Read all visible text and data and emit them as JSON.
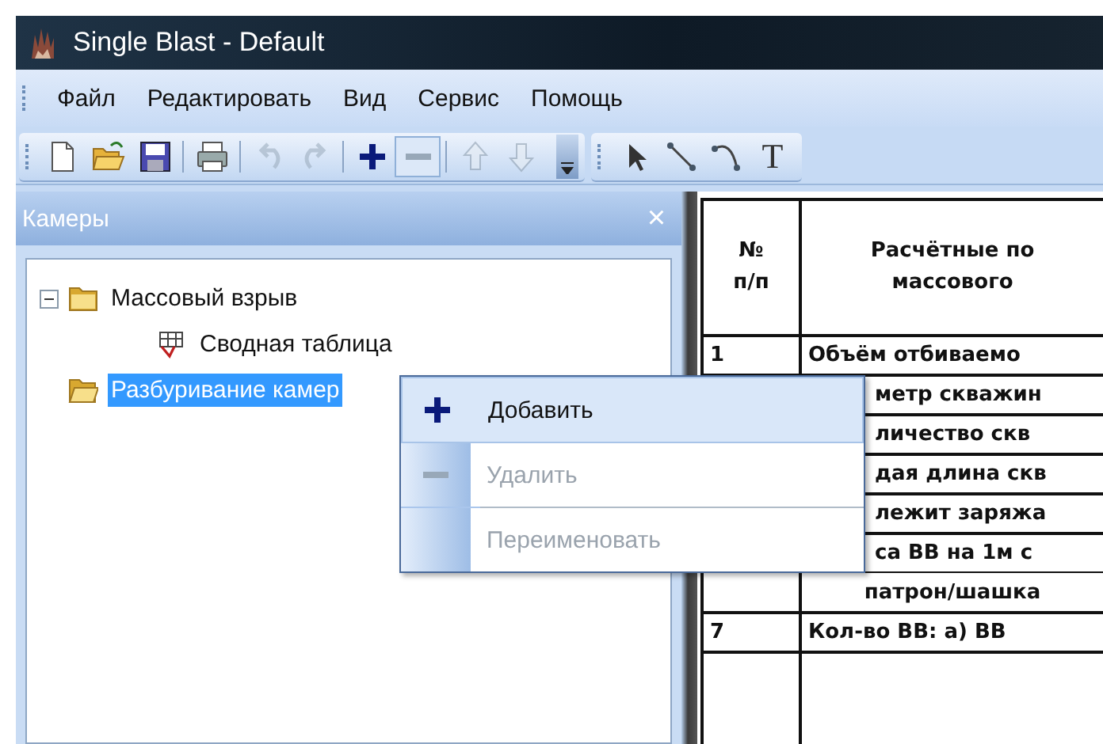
{
  "window": {
    "title": "Single Blast - Default"
  },
  "menu_bar": [
    {
      "label": "Файл"
    },
    {
      "label": "Редактировать"
    },
    {
      "label": "Вид"
    },
    {
      "label": "Сервис"
    },
    {
      "label": "Помощь"
    }
  ],
  "toolbars": [
    {
      "items": [
        {
          "kind": "new",
          "disabled": false
        },
        {
          "kind": "open",
          "disabled": false
        },
        {
          "kind": "save",
          "disabled": false
        },
        {
          "kind": "sep"
        },
        {
          "kind": "print",
          "disabled": false
        },
        {
          "kind": "sep"
        },
        {
          "kind": "undo",
          "disabled": true
        },
        {
          "kind": "redo",
          "disabled": true
        },
        {
          "kind": "sep"
        },
        {
          "kind": "plus",
          "disabled": false
        },
        {
          "kind": "minus",
          "disabled": false,
          "pressed": true
        },
        {
          "kind": "sep"
        },
        {
          "kind": "up",
          "disabled": true
        },
        {
          "kind": "down",
          "disabled": true
        },
        {
          "kind": "overflow"
        }
      ]
    },
    {
      "items": [
        {
          "kind": "pointer",
          "disabled": false
        },
        {
          "kind": "line",
          "disabled": false
        },
        {
          "kind": "curve",
          "disabled": false
        },
        {
          "kind": "text",
          "label": "T",
          "disabled": false
        }
      ]
    }
  ],
  "panel": {
    "title": "Камеры",
    "close": "×",
    "tree": [
      {
        "label": "Массовый взрыв",
        "kind": "folder",
        "expanded": true,
        "selected": false,
        "children": [
          {
            "label": "Сводная таблица",
            "kind": "table",
            "selected": false
          }
        ]
      },
      {
        "label": "Разбуривание камер",
        "kind": "folder",
        "selected": true
      }
    ]
  },
  "context_menu": [
    {
      "kind": "add",
      "label": "Добавить",
      "disabled": false,
      "selected": true
    },
    {
      "kind": "remove",
      "label": "Удалить",
      "disabled": true,
      "selected": false
    },
    {
      "kind": "separator"
    },
    {
      "kind": "plain",
      "label": "Переименовать",
      "disabled": true,
      "selected": false
    }
  ],
  "table": {
    "columns": [
      {
        "lines": [
          "№",
          "п/п"
        ]
      },
      {
        "lines": [
          "Расчётные по",
          "массового"
        ]
      }
    ],
    "rows": [
      {
        "kind": "row",
        "number": "1",
        "text": "Объём отбиваемо"
      },
      {
        "kind": "covered",
        "text": "метр скважин"
      },
      {
        "kind": "covered",
        "text": "личество скв"
      },
      {
        "kind": "covered",
        "text": "дая длина скв"
      },
      {
        "kind": "covered",
        "text": "лежит заряжа"
      },
      {
        "kind": "covered",
        "text": "са ВВ на 1м с"
      },
      {
        "kind": "continuation",
        "text": "патрон/шашка"
      },
      {
        "kind": "row",
        "number": "7",
        "text": "Кол-во ВВ: а) ВВ"
      }
    ]
  }
}
